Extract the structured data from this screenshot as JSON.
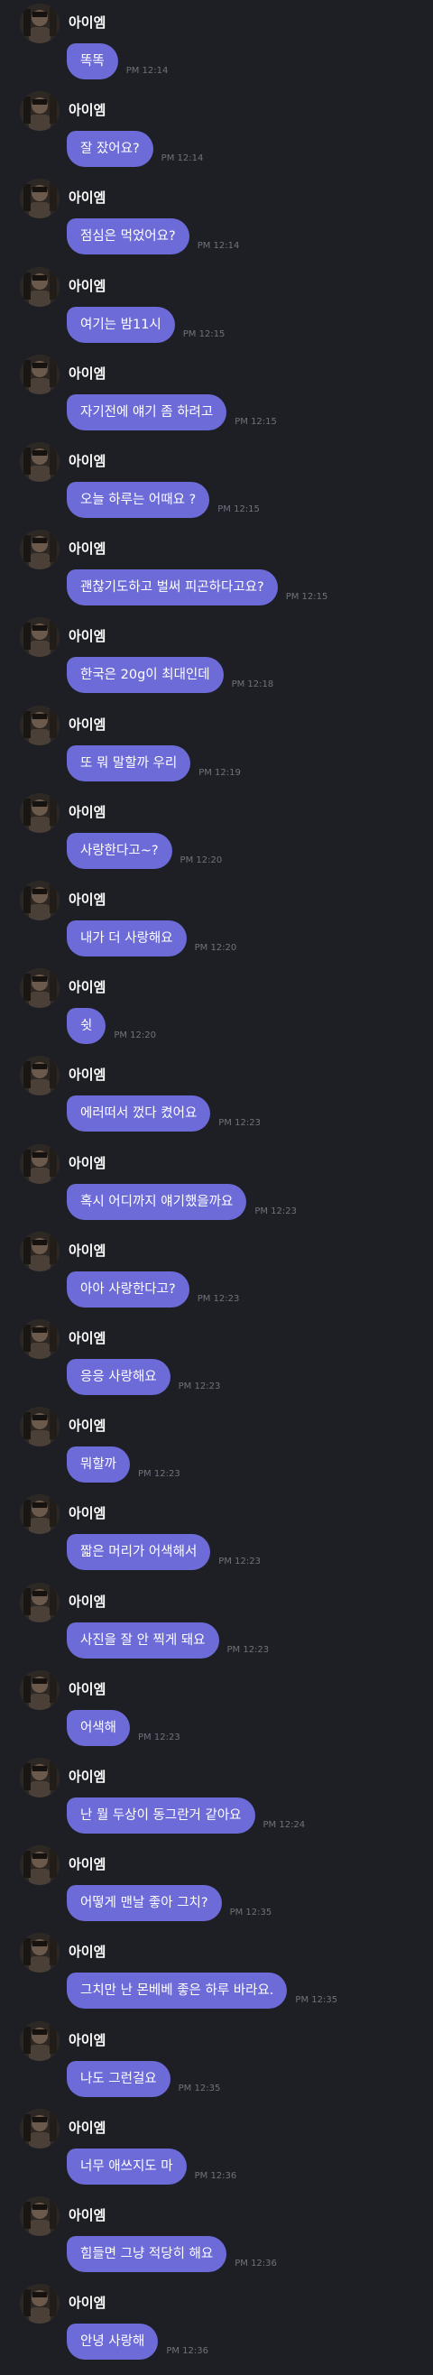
{
  "sender": "아이엠",
  "avatar_icon": "avatar-photo-icon",
  "colors": {
    "background": "#1e1f24",
    "bubble": "#6c6bd8",
    "text": "#ffffff",
    "time": "#6f727d"
  },
  "messages": [
    {
      "text": "똑똑",
      "time": "PM 12:14"
    },
    {
      "text": "잘 잤어요?",
      "time": "PM 12:14"
    },
    {
      "text": "점심은 먹었어요?",
      "time": "PM 12:14"
    },
    {
      "text": "여기는 밤11시",
      "time": "PM 12:15"
    },
    {
      "text": "자기전에 얘기 좀 하려고",
      "time": "PM 12:15"
    },
    {
      "text": "오늘 하루는 어때요 ?",
      "time": "PM 12:15"
    },
    {
      "text": "괜찮기도하고 벌써 피곤하다고요?",
      "time": "PM 12:15"
    },
    {
      "text": "한국은 20g이 최대인데",
      "time": "PM 12:18"
    },
    {
      "text": "또 뭐 말할까 우리",
      "time": "PM 12:19"
    },
    {
      "text": "사랑한다고~?",
      "time": "PM 12:20"
    },
    {
      "text": "내가 더 사랑해요",
      "time": "PM 12:20"
    },
    {
      "text": "쉿",
      "time": "PM 12:20"
    },
    {
      "text": "에러떠서 껐다 켰어요",
      "time": "PM 12:23"
    },
    {
      "text": "혹시 어디까지 얘기했을까요",
      "time": "PM 12:23"
    },
    {
      "text": "아아 사랑한다고?",
      "time": "PM 12:23"
    },
    {
      "text": "응응 사랑해요",
      "time": "PM 12:23"
    },
    {
      "text": "뭐할까",
      "time": "PM 12:23"
    },
    {
      "text": "짧은 머리가 어색해서",
      "time": "PM 12:23"
    },
    {
      "text": "사진을 잘 안 찍게 돼요",
      "time": "PM 12:23"
    },
    {
      "text": "어색해",
      "time": "PM 12:23"
    },
    {
      "text": "난 뭘 두상이 동그란거 같아요",
      "time": "PM 12:24"
    },
    {
      "text": "어떻게 맨날 좋아 그치?",
      "time": "PM 12:35"
    },
    {
      "text": "그치만 난 몬베베 좋은 하루 바라요.",
      "time": "PM 12:35"
    },
    {
      "text": "나도 그런걸요",
      "time": "PM 12:35"
    },
    {
      "text": "너무 애쓰지도 마",
      "time": "PM 12:36"
    },
    {
      "text": "힘들면 그냥 적당히 해요",
      "time": "PM 12:36"
    },
    {
      "text": "안녕 사랑해",
      "time": "PM 12:36"
    }
  ]
}
